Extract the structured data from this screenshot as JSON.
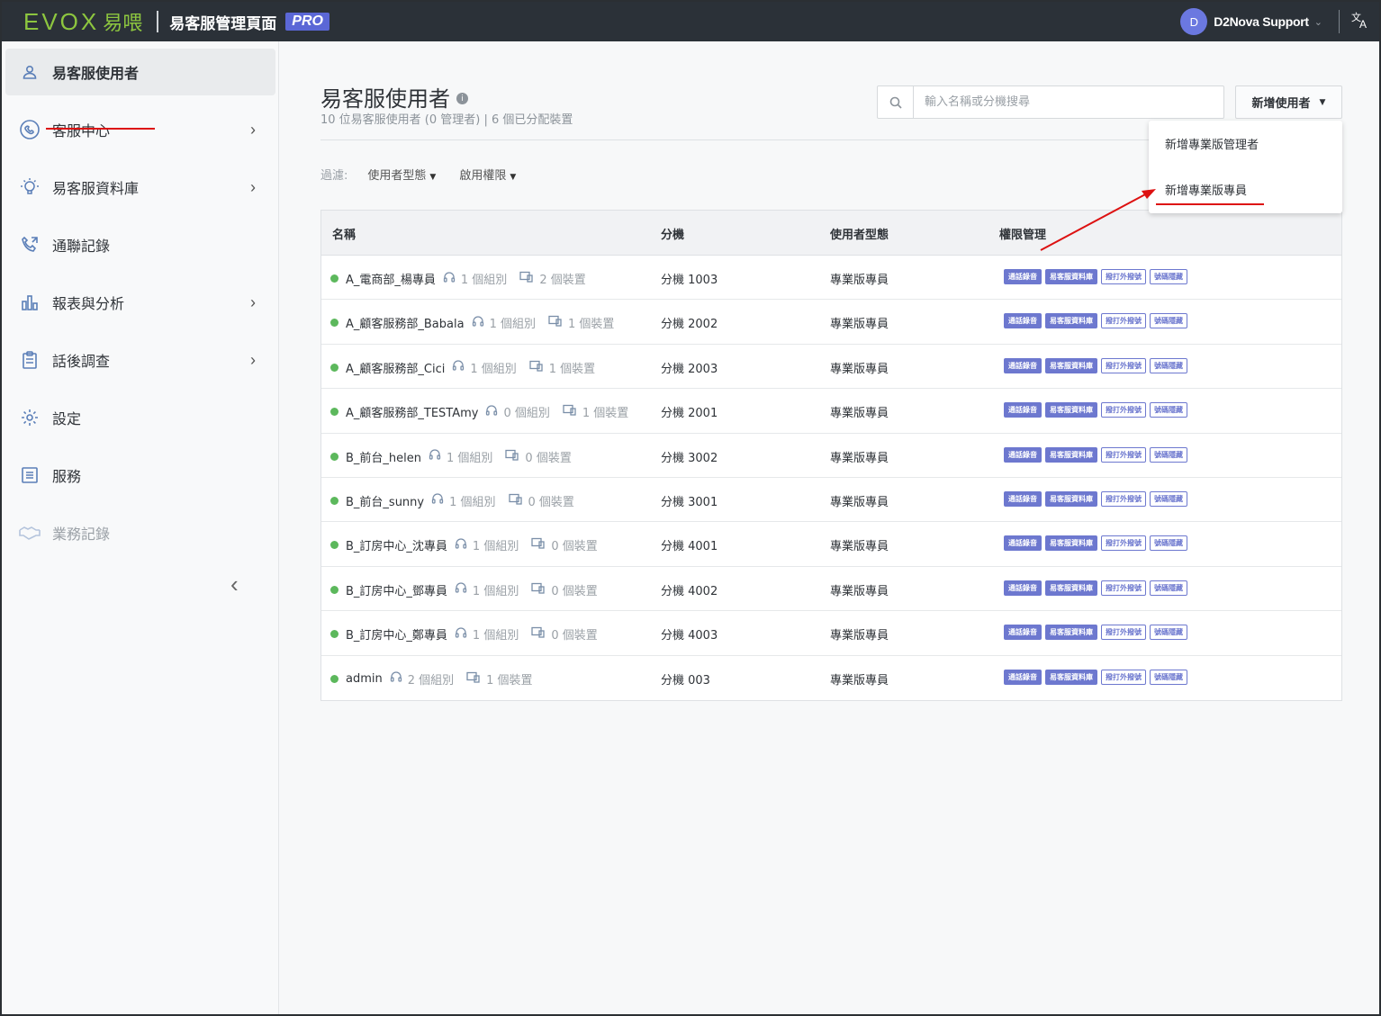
{
  "topbar": {
    "logo_text": "EVOX",
    "logo_cn": "易喂",
    "title": "易客服管理頁面",
    "badge": "PRO",
    "user_initial": "D",
    "user_name": "D2Nova Support",
    "translate_icon": "文A"
  },
  "sidebar": {
    "items": [
      {
        "label": "易客服使用者",
        "icon": "user-icon",
        "active": true,
        "chevron": false
      },
      {
        "label": "客服中心",
        "icon": "headset-icon",
        "chevron": true
      },
      {
        "label": "易客服資料庫",
        "icon": "lightbulb-icon",
        "chevron": true
      },
      {
        "label": "通聯記錄",
        "icon": "phone-icon",
        "chevron": false
      },
      {
        "label": "報表與分析",
        "icon": "bar-chart-icon",
        "chevron": true
      },
      {
        "label": "話後調查",
        "icon": "clipboard-icon",
        "chevron": true
      },
      {
        "label": "設定",
        "icon": "gear-icon",
        "chevron": false
      },
      {
        "label": "服務",
        "icon": "list-icon",
        "chevron": false
      },
      {
        "label": "業務記錄",
        "icon": "handshake-icon",
        "chevron": false,
        "disabled": true
      }
    ]
  },
  "page": {
    "title": "易客服使用者",
    "info_icon": "i",
    "subtitle": "10 位易客服使用者 (0 管理者) | 6 個已分配裝置",
    "search_placeholder": "輸入名稱或分機搜尋",
    "add_button": "新增使用者",
    "dropdown": [
      "新增專業版管理者",
      "新增專業版專員"
    ],
    "filter_label": "過濾:",
    "filters": [
      "使用者型態",
      "啟用權限"
    ]
  },
  "table": {
    "headers": [
      "名稱",
      "分機",
      "使用者型態",
      "權限管理"
    ],
    "tag_labels": [
      "通話錄音",
      "易客服資料庫",
      "撥打外撥號",
      "號碼隱藏"
    ],
    "rows": [
      {
        "name": "A_電商部_楊專員",
        "groups": "1 個組別",
        "devices": "2 個裝置",
        "ext": "分機 1003",
        "type": "專業版專員"
      },
      {
        "name": "A_顧客服務部_Babala",
        "groups": "1 個組別",
        "devices": "1 個裝置",
        "ext": "分機 2002",
        "type": "專業版專員"
      },
      {
        "name": "A_顧客服務部_Cici",
        "groups": "1 個組別",
        "devices": "1 個裝置",
        "ext": "分機 2003",
        "type": "專業版專員"
      },
      {
        "name": "A_顧客服務部_TESTAmy",
        "groups": "0 個組別",
        "devices": "1 個裝置",
        "ext": "分機 2001",
        "type": "專業版專員"
      },
      {
        "name": "B_前台_helen",
        "groups": "1 個組別",
        "devices": "0 個裝置",
        "ext": "分機 3002",
        "type": "專業版專員"
      },
      {
        "name": "B_前台_sunny",
        "groups": "1 個組別",
        "devices": "0 個裝置",
        "ext": "分機 3001",
        "type": "專業版專員"
      },
      {
        "name": "B_訂房中心_沈專員",
        "groups": "1 個組別",
        "devices": "0 個裝置",
        "ext": "分機 4001",
        "type": "專業版專員"
      },
      {
        "name": "B_訂房中心_鄧專員",
        "groups": "1 個組別",
        "devices": "0 個裝置",
        "ext": "分機 4002",
        "type": "專業版專員"
      },
      {
        "name": "B_訂房中心_鄭專員",
        "groups": "1 個組別",
        "devices": "0 個裝置",
        "ext": "分機 4003",
        "type": "專業版專員"
      },
      {
        "name": "admin",
        "groups": "2 個組別",
        "devices": "1 個裝置",
        "ext": "分機 003",
        "type": "專業版專員"
      }
    ]
  },
  "colors": {
    "topbar": "#2b3138",
    "brand_green": "#8dc63f",
    "pro_badge": "#5b67d6",
    "tag": "#6d78cf",
    "status_online": "#5cb85c",
    "annotation_red": "#dd1111"
  }
}
